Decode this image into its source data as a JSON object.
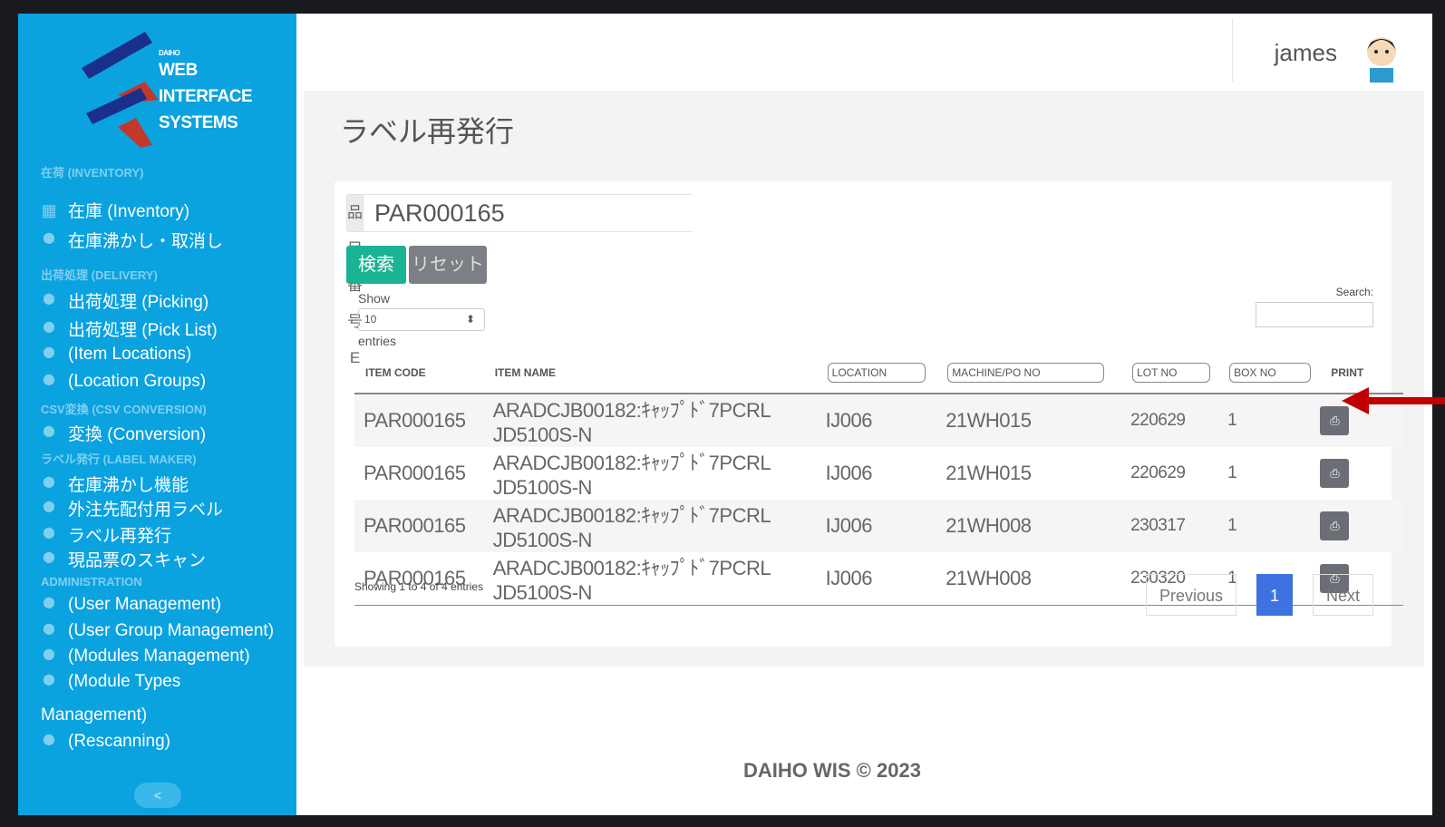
{
  "logo": {
    "lines": [
      "DAIHO",
      "WEB",
      "INTERFACE",
      "SYSTEMS"
    ]
  },
  "sidebar": {
    "sections": [
      {
        "title": "在荷 (INVENTORY)",
        "items": [
          {
            "label": "在庫 (Inventory)",
            "icon": "warehouse-icon"
          },
          {
            "label": "在庫沸かし・取消し",
            "icon": "map-pin-icon"
          }
        ]
      },
      {
        "title": "出荷処理 (DELIVERY)",
        "items": [
          {
            "label": "出荷処理 (Picking)"
          },
          {
            "label": "出荷処理 (Pick List)"
          },
          {
            "label": "(Item Locations)"
          },
          {
            "label": "(Location Groups)"
          }
        ]
      },
      {
        "title": "CSV変換 (CSV CONVERSION)",
        "items": [
          {
            "label": "変換 (Conversion)"
          }
        ]
      },
      {
        "title": "ラベル発行 (LABEL MAKER)",
        "items": [
          {
            "label": "在庫沸かし機能"
          },
          {
            "label": "外注先配付用ラベル"
          },
          {
            "label": "ラベル再発行"
          },
          {
            "label": "現品票のスキャン"
          }
        ]
      },
      {
        "title": "ADMINISTRATION",
        "items": [
          {
            "label": "(User Management)"
          },
          {
            "label": "(User Group Management)"
          },
          {
            "label": "(Modules Management)"
          },
          {
            "label": "(Module Types"
          },
          {
            "label": "Management)"
          },
          {
            "label": "(Rescanning)"
          }
        ]
      }
    ],
    "collapse": "<"
  },
  "header": {
    "username": "james"
  },
  "page": {
    "title": "ラベル再発行"
  },
  "form": {
    "addon": "品目番号E",
    "value": "PAR000165",
    "search": "検索",
    "reset": "リセット"
  },
  "table_controls": {
    "show": "Show",
    "entries_value": "10",
    "entries": "entries",
    "search_label": "Search:"
  },
  "table": {
    "headers": [
      "ITEM CODE",
      "ITEM NAME",
      "LOCATION",
      "MACHINE/PO NO",
      "LOT NO",
      "BOX NO",
      "PRINT"
    ],
    "rows": [
      [
        "PAR000165",
        "ARADCJB00182:ｷｬｯﾌﾟﾄﾞ7PCRL JD5100S-N",
        "IJ006",
        "21WH015",
        "220629",
        "1"
      ],
      [
        "PAR000165",
        "ARADCJB00182:ｷｬｯﾌﾟﾄﾞ7PCRL JD5100S-N",
        "IJ006",
        "21WH015",
        "220629",
        "1"
      ],
      [
        "PAR000165",
        "ARADCJB00182:ｷｬｯﾌﾟﾄﾞ7PCRL JD5100S-N",
        "IJ006",
        "21WH008",
        "230317",
        "1"
      ],
      [
        "PAR000165",
        "ARADCJB00182:ｷｬｯﾌﾟﾄﾞ7PCRL JD5100S-N",
        "IJ006",
        "21WH008",
        "230320",
        "1"
      ]
    ],
    "info": "Showing 1 to 4 of 4 entries",
    "pagination": {
      "previous": "Previous",
      "current": "1",
      "next": "Next"
    }
  },
  "footer": "DAIHO WIS © 2023",
  "colors": {
    "sidebar": "#0ba2e0",
    "search": "#1ab394",
    "page_active": "#3d72e0",
    "annotation_arrow": "#c00000"
  }
}
